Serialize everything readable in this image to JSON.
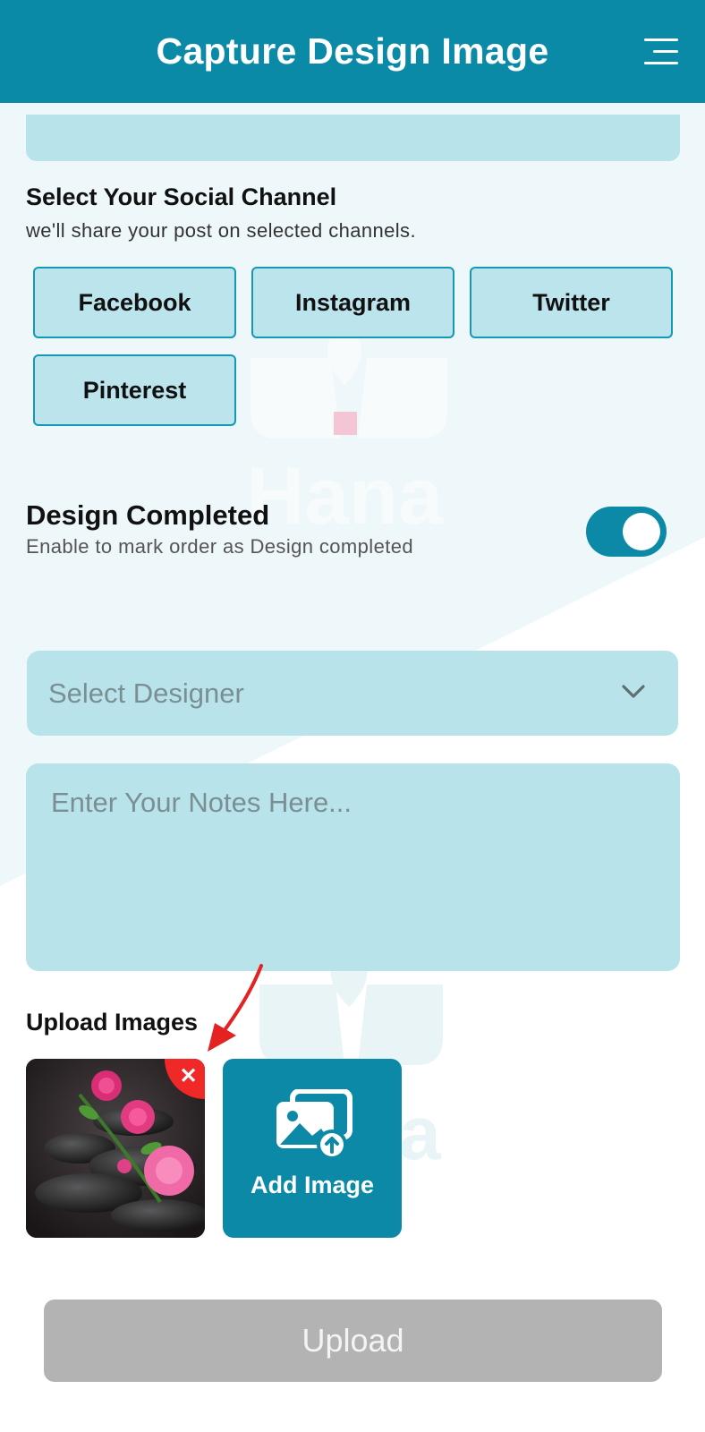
{
  "header": {
    "title": "Capture Design Image"
  },
  "social": {
    "title": "Select Your Social Channel",
    "subtitle": "we'll share your post on selected channels.",
    "channels": [
      "Facebook",
      "Instagram",
      "Twitter",
      "Pinterest"
    ]
  },
  "design_completed": {
    "title": "Design Completed",
    "subtitle": "Enable to mark order as Design completed",
    "enabled": true
  },
  "designer_select": {
    "placeholder": "Select Designer"
  },
  "notes": {
    "placeholder": "Enter Your Notes Here..."
  },
  "upload_images": {
    "title": "Upload Images",
    "add_label": "Add Image",
    "remove_icon": "close-icon"
  },
  "upload_button": {
    "label": "Upload"
  },
  "watermark": {
    "brand": "Hana"
  },
  "colors": {
    "header": "#0b8aa8",
    "field": "#b9e3ea",
    "chip_border": "#1498b4",
    "toggle": "#0b89a6",
    "remove": "#f02828",
    "upload_disabled": "#b3b3b3"
  }
}
